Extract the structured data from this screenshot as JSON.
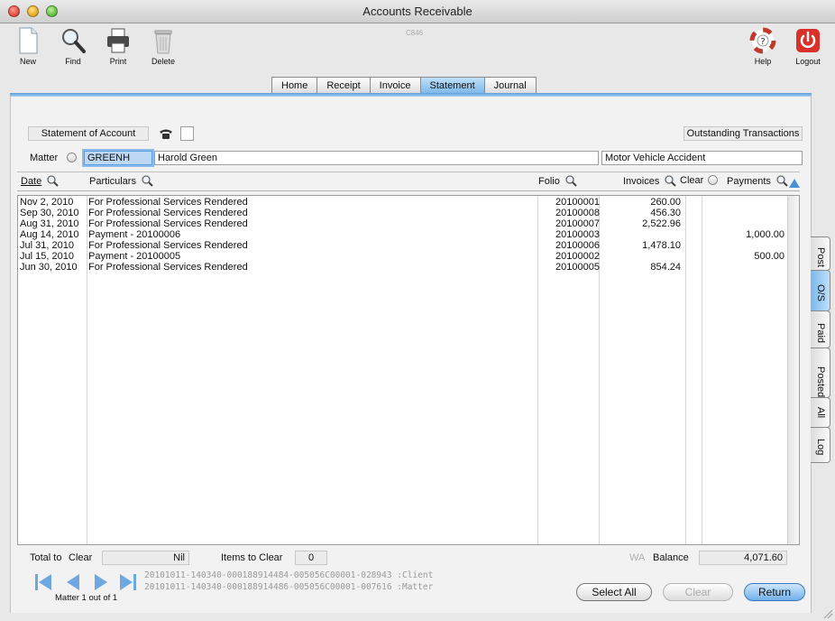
{
  "window": {
    "title": "Accounts Receivable",
    "code": "C846"
  },
  "toolbar": {
    "new": "New",
    "find": "Find",
    "print": "Print",
    "delete": "Delete",
    "help": "Help",
    "logout": "Logout"
  },
  "tabs": [
    "Home",
    "Receipt",
    "Invoice",
    "Statement",
    "Journal"
  ],
  "active_tab": "Statement",
  "header": {
    "statement_label": "Statement of Account",
    "outstanding_label": "Outstanding Transactions",
    "matter_label": "Matter",
    "matter_code": "GREENH",
    "client_name": "Harold Green",
    "matter_description": "Motor Vehicle Accident"
  },
  "columns": {
    "date": "Date",
    "particulars": "Particulars",
    "folio": "Folio",
    "invoices": "Invoices",
    "clear": "Clear",
    "payments": "Payments"
  },
  "rows": [
    {
      "date": "Nov 2, 2010",
      "particulars": "For Professional Services Rendered",
      "folio": "20100001",
      "invoices": "260.00",
      "payments": ""
    },
    {
      "date": "Sep 30, 2010",
      "particulars": "For Professional Services Rendered",
      "folio": "20100008",
      "invoices": "456.30",
      "payments": ""
    },
    {
      "date": "Aug 31, 2010",
      "particulars": "For Professional Services Rendered",
      "folio": "20100007",
      "invoices": "2,522.96",
      "payments": ""
    },
    {
      "date": "Aug 14, 2010",
      "particulars": "Payment - 20100006",
      "folio": "20100003",
      "invoices": "",
      "payments": "1,000.00"
    },
    {
      "date": "Jul 31, 2010",
      "particulars": "For Professional Services Rendered",
      "folio": "20100006",
      "invoices": "1,478.10",
      "payments": ""
    },
    {
      "date": "Jul 15, 2010",
      "particulars": "Payment - 20100005",
      "folio": "20100002",
      "invoices": "",
      "payments": "500.00"
    },
    {
      "date": "Jun 30, 2010",
      "particulars": "For Professional Services Rendered",
      "folio": "20100005",
      "invoices": "854.24",
      "payments": ""
    }
  ],
  "side_tabs": [
    "Post",
    "O/S",
    "Paid",
    "Posted",
    "All",
    "Log"
  ],
  "active_side_tab": "O/S",
  "footer": {
    "total_to_label": "Total to",
    "clear_label": "Clear",
    "total_value": "Nil",
    "items_label": "Items to Clear",
    "items_value": "0",
    "wa_label": "WA",
    "balance_label": "Balance",
    "balance_value": "4,071.60",
    "client_id": "20101011-140340-000188914484-005056C00001-028943 :Client",
    "matter_id": "20101011-140340-000188914486-005056C00001-007616 :Matter",
    "matter_count": "Matter 1 out of 1"
  },
  "buttons": {
    "select_all": "Select All",
    "clear": "Clear",
    "return": "Return"
  },
  "colors": {
    "accent": "#7ab7ea",
    "selection": "#bcd8f5",
    "return_button": "#6fb0ec"
  }
}
